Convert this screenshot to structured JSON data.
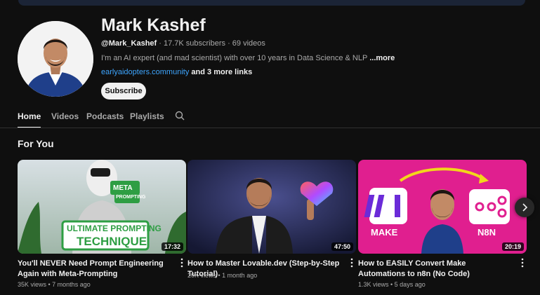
{
  "channel": {
    "name": "Mark Kashef",
    "handle": "@Mark_Kashef",
    "stats": " · 17.7K subscribers · 69 videos",
    "description": "I'm an AI expert (and mad scientist) with over 10 years in Data Science & NLP",
    "more_label": "...more",
    "link": "earlyaidopters.community",
    "more_links": "and 3 more links",
    "subscribe_label": "Subscribe"
  },
  "tabs": [
    {
      "label": "Home",
      "active": true
    },
    {
      "label": "Videos"
    },
    {
      "label": "Podcasts"
    },
    {
      "label": "Playlists"
    }
  ],
  "section": {
    "title": "For You"
  },
  "videos": [
    {
      "title": "You'll NEVER Need Prompt Engineering Again with Meta-Prompting",
      "meta": "35K views • 7 months ago",
      "duration": "17:32",
      "thumb_text": [
        "META",
        "PROMPTING",
        "ULTIMATE PROMPTING",
        "TECHNIQUE"
      ]
    },
    {
      "title": "How to Master Lovable.dev (Step-by-Step Tutorial)",
      "meta": "20K views • 1 month ago",
      "duration": "47:50"
    },
    {
      "title": "How to EASILY Convert Make Automations to n8n (No Code)",
      "meta": "1.3K views • 5 days ago",
      "duration": "20:19",
      "thumb_text": [
        "MAKE",
        "N8N"
      ]
    }
  ],
  "icons": {
    "search": "search-icon",
    "kebab": "more-vert-icon",
    "next": "chevron-right-icon"
  },
  "colors": {
    "background": "#0f0f0f",
    "link": "#3ea6ff",
    "subscribe_bg": "#f1f1f1",
    "thumb3_bg": "#e01f8f"
  }
}
